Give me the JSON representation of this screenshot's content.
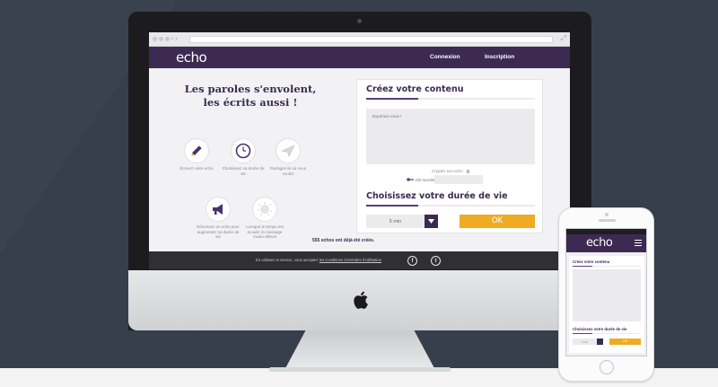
{
  "site": {
    "logo": "echo",
    "nav": {
      "connexion": "Connexion",
      "inscription": "Inscription"
    },
    "tagline": "Les paroles s'envolent, les écrits aussi !",
    "features": [
      {
        "icon": "pencil-icon",
        "label": "Écrivez votre echo"
      },
      {
        "icon": "clock-icon",
        "label": "Choisissez sa durée de vie"
      },
      {
        "icon": "paper-plane-icon",
        "label": "Partagez-le où vous voulez"
      },
      {
        "icon": "megaphone-icon",
        "label": "Résonnez un echo pour augmenter sa durée de vie"
      },
      {
        "icon": "dissolve-icon",
        "label": "Lorsque le temps est écoulé, le message s'auto-détruit"
      }
    ],
    "form": {
      "create_title": "Créez votre contenu",
      "content_placeholder": "Exprimez-vous !",
      "encrypt_label": "Cryptez ton echo :",
      "secret_key_label": "Clé secrète :",
      "duration_title": "Choisissez votre durée de vie",
      "duration_value": "5 min",
      "ok_label": "OK"
    },
    "echo_count": "555 echos ont déjà été créés.",
    "footer": {
      "text": "En utilisant ce service, vous acceptez ",
      "link": "les Conditions Générales d'Utilisation",
      "facebook": "f",
      "twitter": "t"
    }
  },
  "phone": {
    "logo": "echo",
    "create_title": "Créez votre contenu",
    "duration_title": "Choisissez votre durée de vie",
    "duration_value": "5 min",
    "ok_label": "OK"
  },
  "colors": {
    "brand_purple": "#3c2a52",
    "accent_orange": "#f0ab22",
    "background": "#3a4250"
  }
}
